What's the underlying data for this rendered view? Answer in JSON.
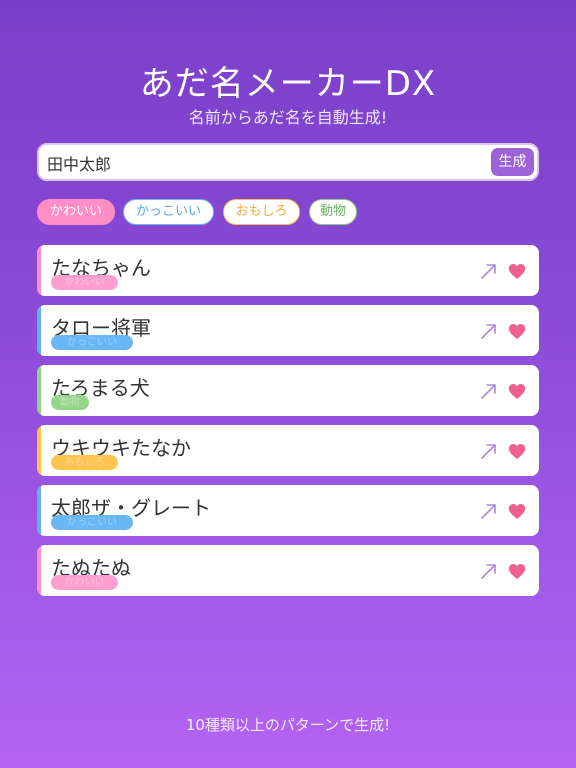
{
  "header": {
    "title": "あだ名メーカーDX",
    "subtitle": "名前からあだ名を自動生成!"
  },
  "search": {
    "value": "田中太郎",
    "button_label": "生成"
  },
  "chips": {
    "cute": "かわいい",
    "cool": "かっこいい",
    "fun": "おもしろ",
    "animal": "動物"
  },
  "colors": {
    "cute": "#ff8ec6",
    "cool": "#62b0f2",
    "fun": "#ffc145",
    "animal": "#8fd383",
    "heart": "#f25f8e",
    "share": "#a88bd6"
  },
  "results": [
    {
      "name": "たなちゃん",
      "category": "かわいい"
    },
    {
      "name": "タロー将軍",
      "category": "かっこいい"
    },
    {
      "name": "たろまる犬",
      "category": "動物"
    },
    {
      "name": "ウキウキたなか",
      "category": "おもしろ"
    },
    {
      "name": "太郎ザ・グレート",
      "category": "かっこいい"
    },
    {
      "name": "たぬたぬ",
      "category": "かわいい"
    }
  ],
  "icons": {
    "share": "arrow-up-right-icon",
    "favorite": "heart-icon"
  },
  "footer": {
    "note": "10種類以上のパターンで生成!"
  }
}
